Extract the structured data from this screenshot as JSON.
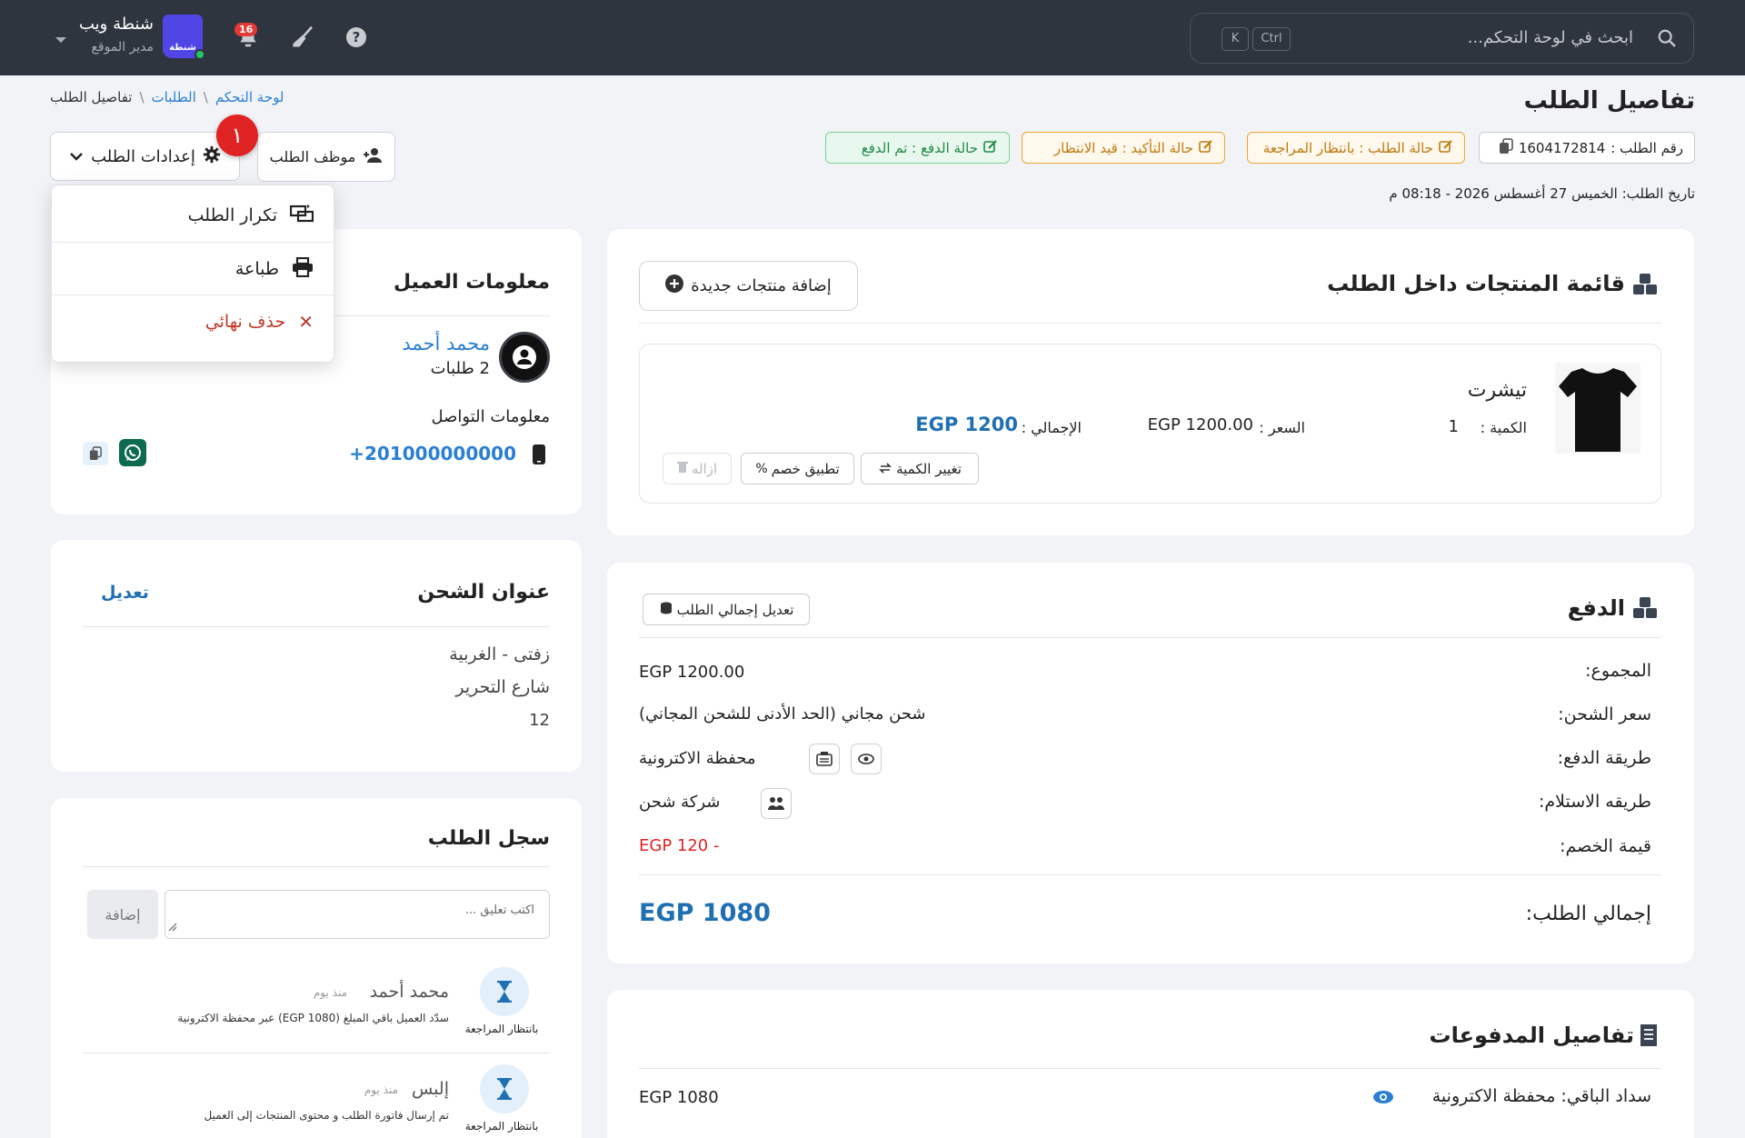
{
  "topbar": {
    "search_placeholder": "ابحث في لوحة التحكم...",
    "kbd_ctrl": "Ctrl",
    "kbd_k": "K",
    "notifications_count": "16",
    "brand_name": "شنطة ويب",
    "brand_role": "مدير الموقع",
    "logo_text": "شنطة"
  },
  "breadcrumb": {
    "home": "لوحة التحكم",
    "orders": "الطلبات",
    "current": "تفاصيل الطلب",
    "sep": "\\"
  },
  "page_title": "تفاصيل الطلب",
  "status_chips": {
    "order_number_label": "رقم الطلب :",
    "order_number": "1604172814",
    "order_status": "حالة الطلب :  بانتظار المراجعة",
    "confirm_status": "حالة التأكيد :  قيد الانتظار",
    "payment_status": "حالة الدفع :  تم الدفع"
  },
  "order_date": "تاريخ الطلب: الخميس 27 أغسطس 2026 - 08:18 م",
  "actions": {
    "order_settings": "إعدادات الطلب",
    "order_employee": "موظف الطلب",
    "step_number": "١"
  },
  "dropdown": {
    "duplicate": "تكرار الطلب",
    "print": "طباعة",
    "delete": "حذف نهائي"
  },
  "products_card": {
    "title": "قائمة المنتجات داخل الطلب",
    "add_button": "إضافة منتجات جديدة",
    "product": {
      "name": "تيشرت",
      "qty_label": "الكمية :",
      "qty": "1",
      "price_label": "السعر :",
      "price": "EGP 1200.00",
      "total_label": "الإجمالي :",
      "total": "EGP 1200"
    },
    "btn_change_qty": "تغيير الكمية",
    "btn_discount": "تطبيق خصم",
    "btn_remove": "ازاله"
  },
  "payment_card": {
    "title": "الدفع",
    "edit_total": "تعديل إجمالي الطلب",
    "subtotal_label": "المجموع:",
    "subtotal": "EGP 1200.00",
    "shipping_label": "سعر الشحن:",
    "shipping": "شحن مجاني (الحد الأدنى للشحن المجاني)",
    "method_label": "طريقة الدفع:",
    "method": "محفظة الاكترونية",
    "delivery_label": "طريقه الاستلام:",
    "delivery": "شركة شحن",
    "discount_label": "قيمة الخصم:",
    "discount": "EGP 120 -",
    "total_label": "إجمالي الطلب:",
    "total": "EGP 1080"
  },
  "payments_details": {
    "title": "تفاصيل المدفوعات",
    "row_label": "سداد الباقي: محفظة الاكترونية",
    "row_value": "EGP 1080"
  },
  "customer_card": {
    "title": "معلومات العميل",
    "name": "محمد أحمد",
    "orders_count": "2 طلبات",
    "contact_title": "معلومات التواصل",
    "phone": "+201000000000"
  },
  "shipping_card": {
    "title": "عنوان الشحن",
    "edit": "تعديل",
    "line1": "زفتى - الغربية",
    "line2": "شارع التحرير",
    "line3": "12"
  },
  "log_card": {
    "title": "سجل الطلب",
    "comment_placeholder": "اكتب تعليق ...",
    "add_button": "إضافة",
    "entries": [
      {
        "name": "محمد أحمد",
        "time": "منذ يوم",
        "text": "سدّد العميل باقي المبلغ (EGP 1080) عبر محفظة الاكترونية",
        "status": "بانتظار المراجعة"
      },
      {
        "name": "إلبس",
        "time": "منذ يوم",
        "text": "تم إرسال فاتورة الطلب و محتوى المنتجات إلى العميل",
        "status": "بانتظار المراجعة"
      }
    ]
  },
  "colors": {
    "topbar": "#2f353e",
    "link": "#2a7fd4",
    "total_blue": "#1f6fb2",
    "danger": "#e02424"
  }
}
